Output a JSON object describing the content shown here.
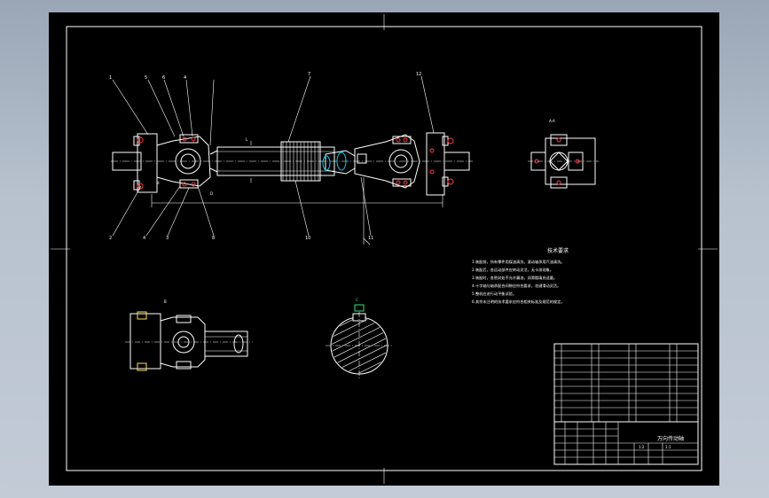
{
  "drawing": {
    "balloons": [
      "1",
      "5",
      "6",
      "4",
      "7",
      "12",
      "2",
      "4",
      "3",
      "8",
      "10",
      "11"
    ],
    "view_labels": [
      "A-A",
      "B",
      "C"
    ],
    "dimension_text": [
      "L",
      "d",
      "D",
      "B",
      "C"
    ],
    "tech_notes_title": "技术要求",
    "tech_notes": [
      "1.装配前，所有零件用煤油清洗，滚动轴承用汽油清洗。",
      "2.装配后，各运动部件应转动灵活，无卡滞现象。",
      "3.装配时，各密封处不允许漏油，润滑脂填充适量。",
      "4.十字轴与轴承配合间隙应符合要求，花键滑动灵活。",
      "5.整机应进行动平衡试验。",
      "6.其余未注明的技术要求应符合相关标准及规范的规定。"
    ],
    "title_block": {
      "drawing_name": "万向传动轴",
      "scale": "1:2",
      "sheet": "1:1"
    }
  }
}
